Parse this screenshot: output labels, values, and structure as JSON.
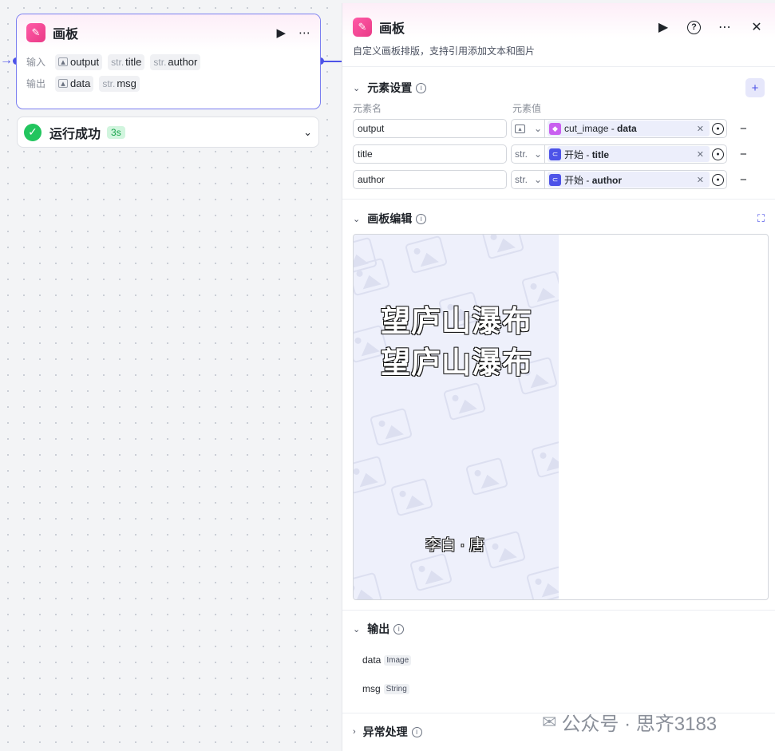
{
  "node": {
    "title": "画板",
    "input_label": "输入",
    "output_label": "输出",
    "inputs": [
      {
        "type": "img",
        "name": "output"
      },
      {
        "type": "str.",
        "name": "title"
      },
      {
        "type": "str.",
        "name": "author"
      }
    ],
    "outputs": [
      {
        "type": "img",
        "name": "data"
      },
      {
        "type": "str.",
        "name": "msg"
      }
    ],
    "status": "运行成功",
    "duration": "3s"
  },
  "panel": {
    "title": "画板",
    "description": "自定义画板排版，支持引用添加文本和图片",
    "elements_section": "元素设置",
    "col_name": "元素名",
    "col_value": "元素值",
    "elements": [
      {
        "name": "output",
        "type": "img",
        "ref_source": "cut_image",
        "ref_sep": " - ",
        "ref_field": "data",
        "ref_color": "#c95ff0"
      },
      {
        "name": "title",
        "type": "str.",
        "ref_source": "开始",
        "ref_sep": " - ",
        "ref_field": "title",
        "ref_color": "#4d53e8"
      },
      {
        "name": "author",
        "type": "str.",
        "ref_source": "开始",
        "ref_sep": " - ",
        "ref_field": "author",
        "ref_color": "#4d53e8"
      }
    ],
    "board_section": "画板编辑",
    "board": {
      "title_line1": "望庐山瀑布",
      "title_line2": "望庐山瀑布",
      "author_line": "李白 · 唐"
    },
    "output_section": "输出",
    "outputs": [
      {
        "name": "data",
        "type": "Image"
      },
      {
        "name": "msg",
        "type": "String"
      }
    ],
    "exception_section": "异常处理"
  },
  "watermark": "公众号 · 思齐3183",
  "colors": {
    "accent": "#4d53e8",
    "success": "#22c55e",
    "brand_pink": "#e93a86"
  }
}
